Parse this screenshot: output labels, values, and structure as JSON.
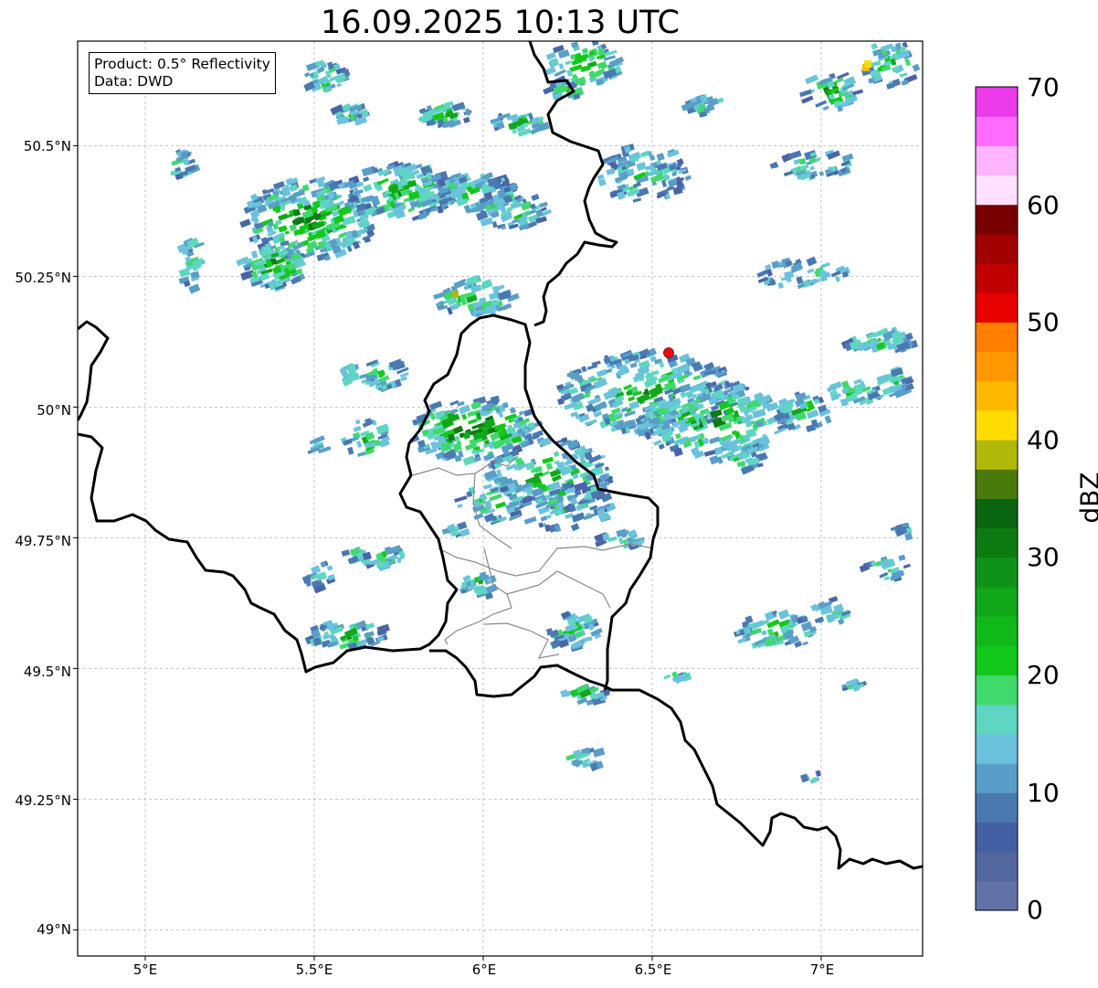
{
  "title": "16.09.2025 10:13 UTC",
  "info": {
    "product": "Product: 0.5° Reflectivity",
    "data": "Data: DWD"
  },
  "axes": {
    "lon_ticks": [
      "5°E",
      "5.5°E",
      "6°E",
      "6.5°E",
      "7°E"
    ],
    "lat_ticks": [
      "50.5°N",
      "50.25°N",
      "50°N",
      "49.75°N",
      "49.5°N",
      "49.25°N",
      "49°N"
    ],
    "lon_range": [
      4.8,
      7.3
    ],
    "lat_range": [
      48.95,
      50.7
    ],
    "grid": true
  },
  "colorbar": {
    "label": "dBZ",
    "range": [
      0,
      70
    ],
    "tick_labels": [
      "0",
      "10",
      "20",
      "30",
      "40",
      "50",
      "60",
      "70"
    ],
    "colors": [
      "#6272a6",
      "#53679f",
      "#4460a4",
      "#4a79b1",
      "#599ec8",
      "#6ac2dc",
      "#5ed6c2",
      "#3fd96c",
      "#12c81a",
      "#10b81a",
      "#10a81a",
      "#0f9218",
      "#0c7b12",
      "#0a6510",
      "#4a7a0c",
      "#b0b80a",
      "#ffdc00",
      "#ffb800",
      "#ff9800",
      "#ff7e00",
      "#e60000",
      "#c00000",
      "#a00000",
      "#780000",
      "#ffe0ff",
      "#ffb4ff",
      "#ff6cff",
      "#ea3aea"
    ]
  },
  "radar_site": {
    "lon": 6.55,
    "lat": 50.11,
    "color": "#ff0000"
  }
}
